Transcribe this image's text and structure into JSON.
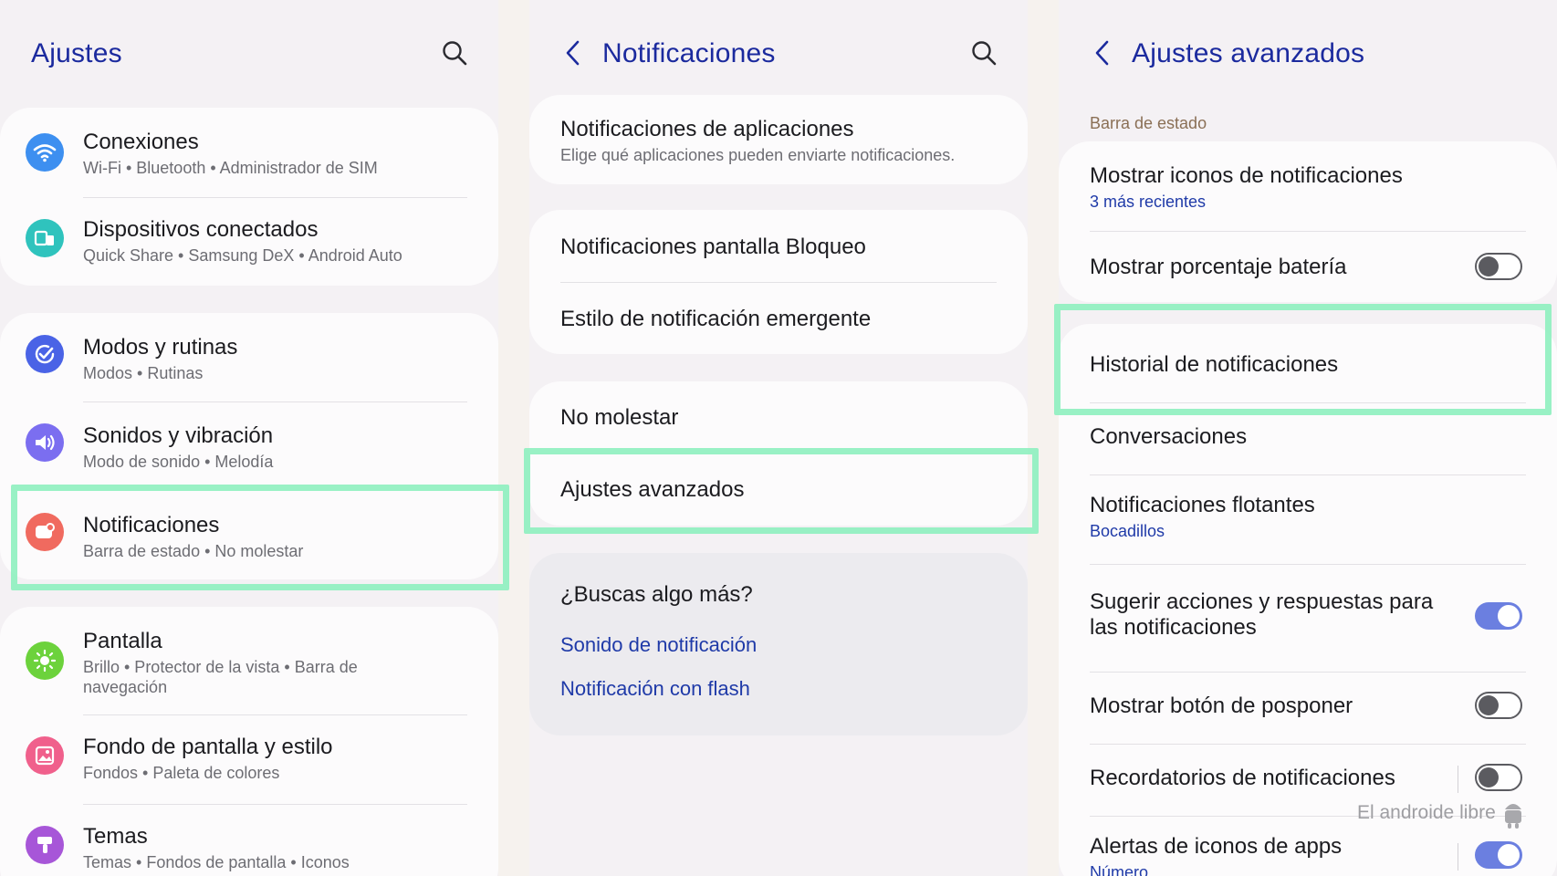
{
  "panel1": {
    "title": "Ajustes",
    "items": [
      {
        "title": "Conexiones",
        "subtitle": "Wi-Fi  •  Bluetooth  •  Administrador de SIM",
        "icon": "wifi-icon",
        "color": "#3d8ff0"
      },
      {
        "title": "Dispositivos conectados",
        "subtitle": "Quick Share  •  Samsung DeX  •  Android Auto",
        "icon": "devices-icon",
        "color": "#2fc3bd"
      },
      {
        "title": "Modos y rutinas",
        "subtitle": "Modos  •  Rutinas",
        "icon": "check-circle-icon",
        "color": "#4a63e6"
      },
      {
        "title": "Sonidos y vibración",
        "subtitle": "Modo de sonido  •  Melodía",
        "icon": "speaker-icon",
        "color": "#7b6ef0"
      },
      {
        "title": "Notificaciones",
        "subtitle": "Barra de estado  •  No molestar",
        "icon": "notification-icon",
        "color": "#f06a5f"
      },
      {
        "title": "Pantalla",
        "subtitle": "Brillo  •  Protector de la vista  •  Barra de",
        "subtitle2": "navegación",
        "icon": "sun-icon",
        "color": "#6cd23c"
      },
      {
        "title": "Fondo de pantalla y estilo",
        "subtitle": "Fondos  •  Paleta de colores",
        "icon": "image-icon",
        "color": "#f0608c"
      },
      {
        "title": "Temas",
        "subtitle": "Temas  •  Fondos de pantalla  •  Iconos",
        "icon": "brush-icon",
        "color": "#a756d8"
      }
    ]
  },
  "panel2": {
    "title": "Notificaciones",
    "app_notifications": {
      "title": "Notificaciones de aplicaciones",
      "subtitle": "Elige qué aplicaciones pueden enviarte notificaciones."
    },
    "lock_screen": "Notificaciones pantalla Bloqueo",
    "popup_style": "Estilo de notificación emergente",
    "do_not_disturb": "No molestar",
    "advanced": "Ajustes avanzados",
    "looking_for": "¿Buscas algo más?",
    "links": [
      "Sonido de notificación",
      "Notificación con flash"
    ]
  },
  "panel3": {
    "title": "Ajustes avanzados",
    "section": "Barra de estado",
    "items": [
      {
        "title": "Mostrar iconos de notificaciones",
        "subtitle": "3 más recientes"
      },
      {
        "title": "Mostrar porcentaje batería",
        "toggle": "off"
      },
      {
        "title": "Historial de notificaciones"
      },
      {
        "title": "Conversaciones"
      },
      {
        "title": "Notificaciones flotantes",
        "subtitle": "Bocadillos"
      },
      {
        "title": "Sugerir acciones y respuestas para",
        "title2": "las notificaciones",
        "toggle": "on"
      },
      {
        "title": "Mostrar botón de posponer",
        "toggle": "off"
      },
      {
        "title": "Recordatorios de notificaciones",
        "toggle": "off"
      },
      {
        "title": "Alertas de iconos de apps",
        "subtitle": "Número",
        "toggle": "on"
      }
    ]
  },
  "watermark": "El androide libre",
  "colors": {
    "accent": "#1b2a9e",
    "link": "#1f3aa8",
    "highlight": "#8ef0bf",
    "toggle_on": "#6b7fe0"
  }
}
